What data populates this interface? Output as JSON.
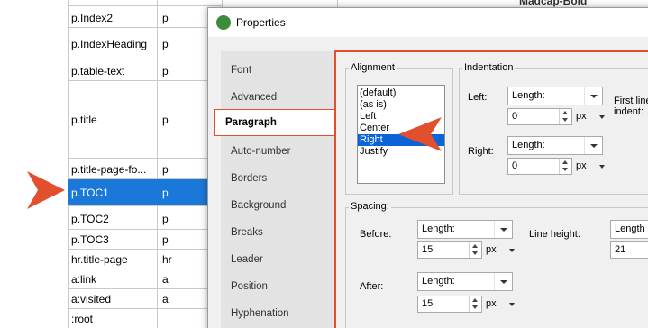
{
  "background_table": {
    "header_fragment": "Madcap-Bold",
    "rows": [
      {
        "name": "p.Index2",
        "tag": "p"
      },
      {
        "name": "p.IndexHeading",
        "tag": "p"
      },
      {
        "name": "p.table-text",
        "tag": "p"
      },
      {
        "name": "p.title",
        "tag": "p"
      },
      {
        "name": "p.title-page-fo...",
        "tag": "p"
      },
      {
        "name": "p.TOC1",
        "tag": "p"
      },
      {
        "name": "p.TOC2",
        "tag": "p"
      },
      {
        "name": "p.TOC3",
        "tag": "p"
      },
      {
        "name": "hr.title-page",
        "tag": "hr"
      },
      {
        "name": "a:link",
        "tag": "a"
      },
      {
        "name": "a:visited",
        "tag": "a"
      },
      {
        "name": ":root",
        "tag": ""
      }
    ],
    "selected_row": "p.TOC1"
  },
  "dialog": {
    "title": "Properties",
    "nav": [
      "Font",
      "Advanced",
      "Paragraph",
      "Auto-number",
      "Borders",
      "Background",
      "Breaks",
      "Leader",
      "Position",
      "Hyphenation"
    ],
    "active_nav": "Paragraph",
    "alignment": {
      "label": "Alignment",
      "options": [
        "(default)",
        "(as is)",
        "Left",
        "Center",
        "Right",
        "Justify"
      ],
      "selected": "Right"
    },
    "indentation": {
      "label": "Indentation",
      "left_label": "Left:",
      "left_type": "Length:",
      "left_value": "0",
      "left_unit": "px",
      "right_label": "Right:",
      "right_type": "Length:",
      "right_value": "0",
      "right_unit": "px",
      "first_line_label_1": "First line",
      "first_line_label_2": "indent:"
    },
    "spacing": {
      "label": "Spacing:",
      "before_label": "Before:",
      "before_type": "Length:",
      "before_value": "15",
      "before_unit": "px",
      "after_label": "After:",
      "after_type": "Length:",
      "after_value": "15",
      "after_unit": "px",
      "line_height_label": "Line height:",
      "line_height_type": "Length",
      "line_height_value": "21"
    }
  },
  "colors": {
    "selection": "#1a78d8",
    "callout": "#e24f2e",
    "list_selection": "#0a64d8"
  },
  "icons": {
    "app": "app-logo-icon",
    "callout": "callout-arrow-icon"
  }
}
